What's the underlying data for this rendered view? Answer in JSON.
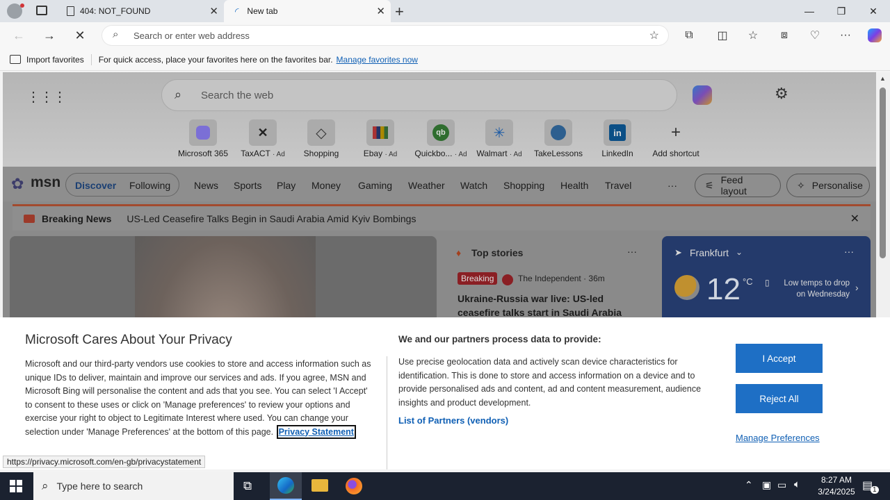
{
  "tabs": [
    {
      "title": "404: NOT_FOUND"
    },
    {
      "title": "New tab"
    }
  ],
  "address_bar": {
    "placeholder": "Search or enter web address"
  },
  "favorites_bar": {
    "import_label": "Import favorites",
    "hint": "For quick access, place your favorites here on the favorites bar.",
    "manage_link": "Manage favorites now"
  },
  "newtab": {
    "search_placeholder": "Search the web",
    "shortcuts": [
      {
        "label": "Microsoft 365",
        "ad": ""
      },
      {
        "label": "TaxACT",
        "ad": "· Ad"
      },
      {
        "label": "Shopping",
        "ad": ""
      },
      {
        "label": "Ebay",
        "ad": "· Ad"
      },
      {
        "label": "Quickbo...",
        "ad": "· Ad"
      },
      {
        "label": "Walmart",
        "ad": "· Ad"
      },
      {
        "label": "TakeLessons",
        "ad": ""
      },
      {
        "label": "LinkedIn",
        "ad": ""
      },
      {
        "label": "Add shortcut",
        "ad": ""
      }
    ]
  },
  "msn": {
    "logo": "msn",
    "primary_tabs": [
      "Discover",
      "Following"
    ],
    "nav_items": [
      "News",
      "Sports",
      "Play",
      "Money",
      "Gaming",
      "Weather",
      "Watch",
      "Shopping",
      "Health",
      "Travel"
    ],
    "more": "···",
    "feed_layout": "Feed layout",
    "personalise": "Personalise",
    "breaking_label": "Breaking News",
    "breaking_headline": "US-Led Ceasefire Talks Begin in Saudi Arabia Amid Kyiv Bombings",
    "top_stories": {
      "title": "Top stories",
      "badge": "Breaking",
      "source": "The Independent · 36m",
      "headline": "Ukraine-Russia war live: US-led ceasefire talks start in Saudi Arabia after Putin..."
    },
    "weather": {
      "location": "Frankfurt",
      "temp": "12",
      "unit": "°C",
      "note": "Low temps to drop on Wednesday"
    }
  },
  "privacy": {
    "title": "Microsoft Cares About Your Privacy",
    "body": "Microsoft and our third-party vendors use cookies to store and access information such as unique IDs to deliver, maintain and improve our services and ads. If you agree, MSN and Microsoft Bing will personalise the content and ads that you see. You can select 'I Accept' to consent to these uses or click on 'Manage preferences' to review your options and exercise your right to object to Legitimate Interest where used.  You can change your selection under 'Manage Preferences' at the bottom of this page.",
    "privacy_link": "Privacy Statement",
    "right_title": "We and our partners process data to provide:",
    "right_body": "Use precise geolocation data and actively scan device characteristics for identification. This is done to store and access information on a device and to provide personalised ads and content, ad and content measurement, audience insights and product development.",
    "partners_link": "List of Partners (vendors)",
    "accept": "I Accept",
    "reject": "Reject All",
    "manage": "Manage Preferences"
  },
  "status_url": "https://privacy.microsoft.com/en-gb/privacystatement",
  "taskbar": {
    "search_placeholder": "Type here to search",
    "time": "8:27 AM",
    "date": "3/24/2025",
    "notification_count": "1"
  },
  "colors": {
    "accent": "#1e6fc5",
    "link": "#0f5fb4",
    "breaking_red": "#c4262e",
    "taskbar": "#1b2230"
  }
}
